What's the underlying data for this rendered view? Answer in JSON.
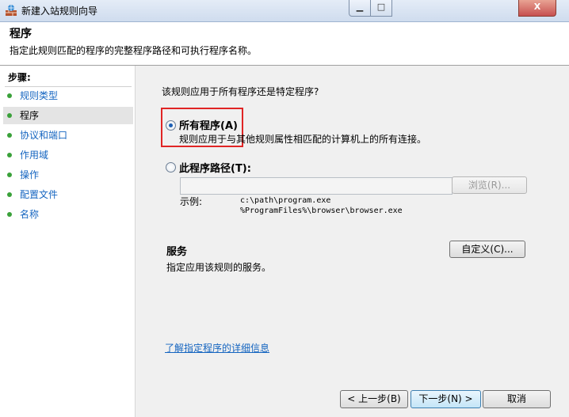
{
  "window": {
    "title": "新建入站规则向导",
    "close_glyph": "X"
  },
  "header": {
    "title": "程序",
    "description": "指定此规则匹配的程序的完整程序路径和可执行程序名称。"
  },
  "steps": {
    "heading": "步骤:",
    "items": [
      {
        "label": "规则类型",
        "active": false
      },
      {
        "label": "程序",
        "active": true
      },
      {
        "label": "协议和端口",
        "active": false
      },
      {
        "label": "作用域",
        "active": false
      },
      {
        "label": "操作",
        "active": false
      },
      {
        "label": "配置文件",
        "active": false
      },
      {
        "label": "名称",
        "active": false
      }
    ],
    "bullet_color": "#3aa13a"
  },
  "main": {
    "question": "该规则应用于所有程序还是特定程序?",
    "all_programs": {
      "label": "所有程序(A)",
      "description": "规则应用于与其他规则属性相匹配的计算机上的所有连接。",
      "checked": true
    },
    "this_program": {
      "label": "此程序路径(T):",
      "checked": false,
      "value": ""
    },
    "browse_label": "浏览(R)...",
    "example_label": "示例:",
    "example_lines": [
      "c:\\path\\program.exe",
      "%ProgramFiles%\\browser\\browser.exe"
    ],
    "services_title": "服务",
    "services_desc": "指定应用该规则的服务。",
    "customize_label": "自定义(C)...",
    "learn_more": "了解指定程序的详细信息",
    "highlight_color": "#e02525"
  },
  "buttons": {
    "back": "< 上一步(B)",
    "next": "下一步(N) >",
    "cancel": "取消"
  }
}
